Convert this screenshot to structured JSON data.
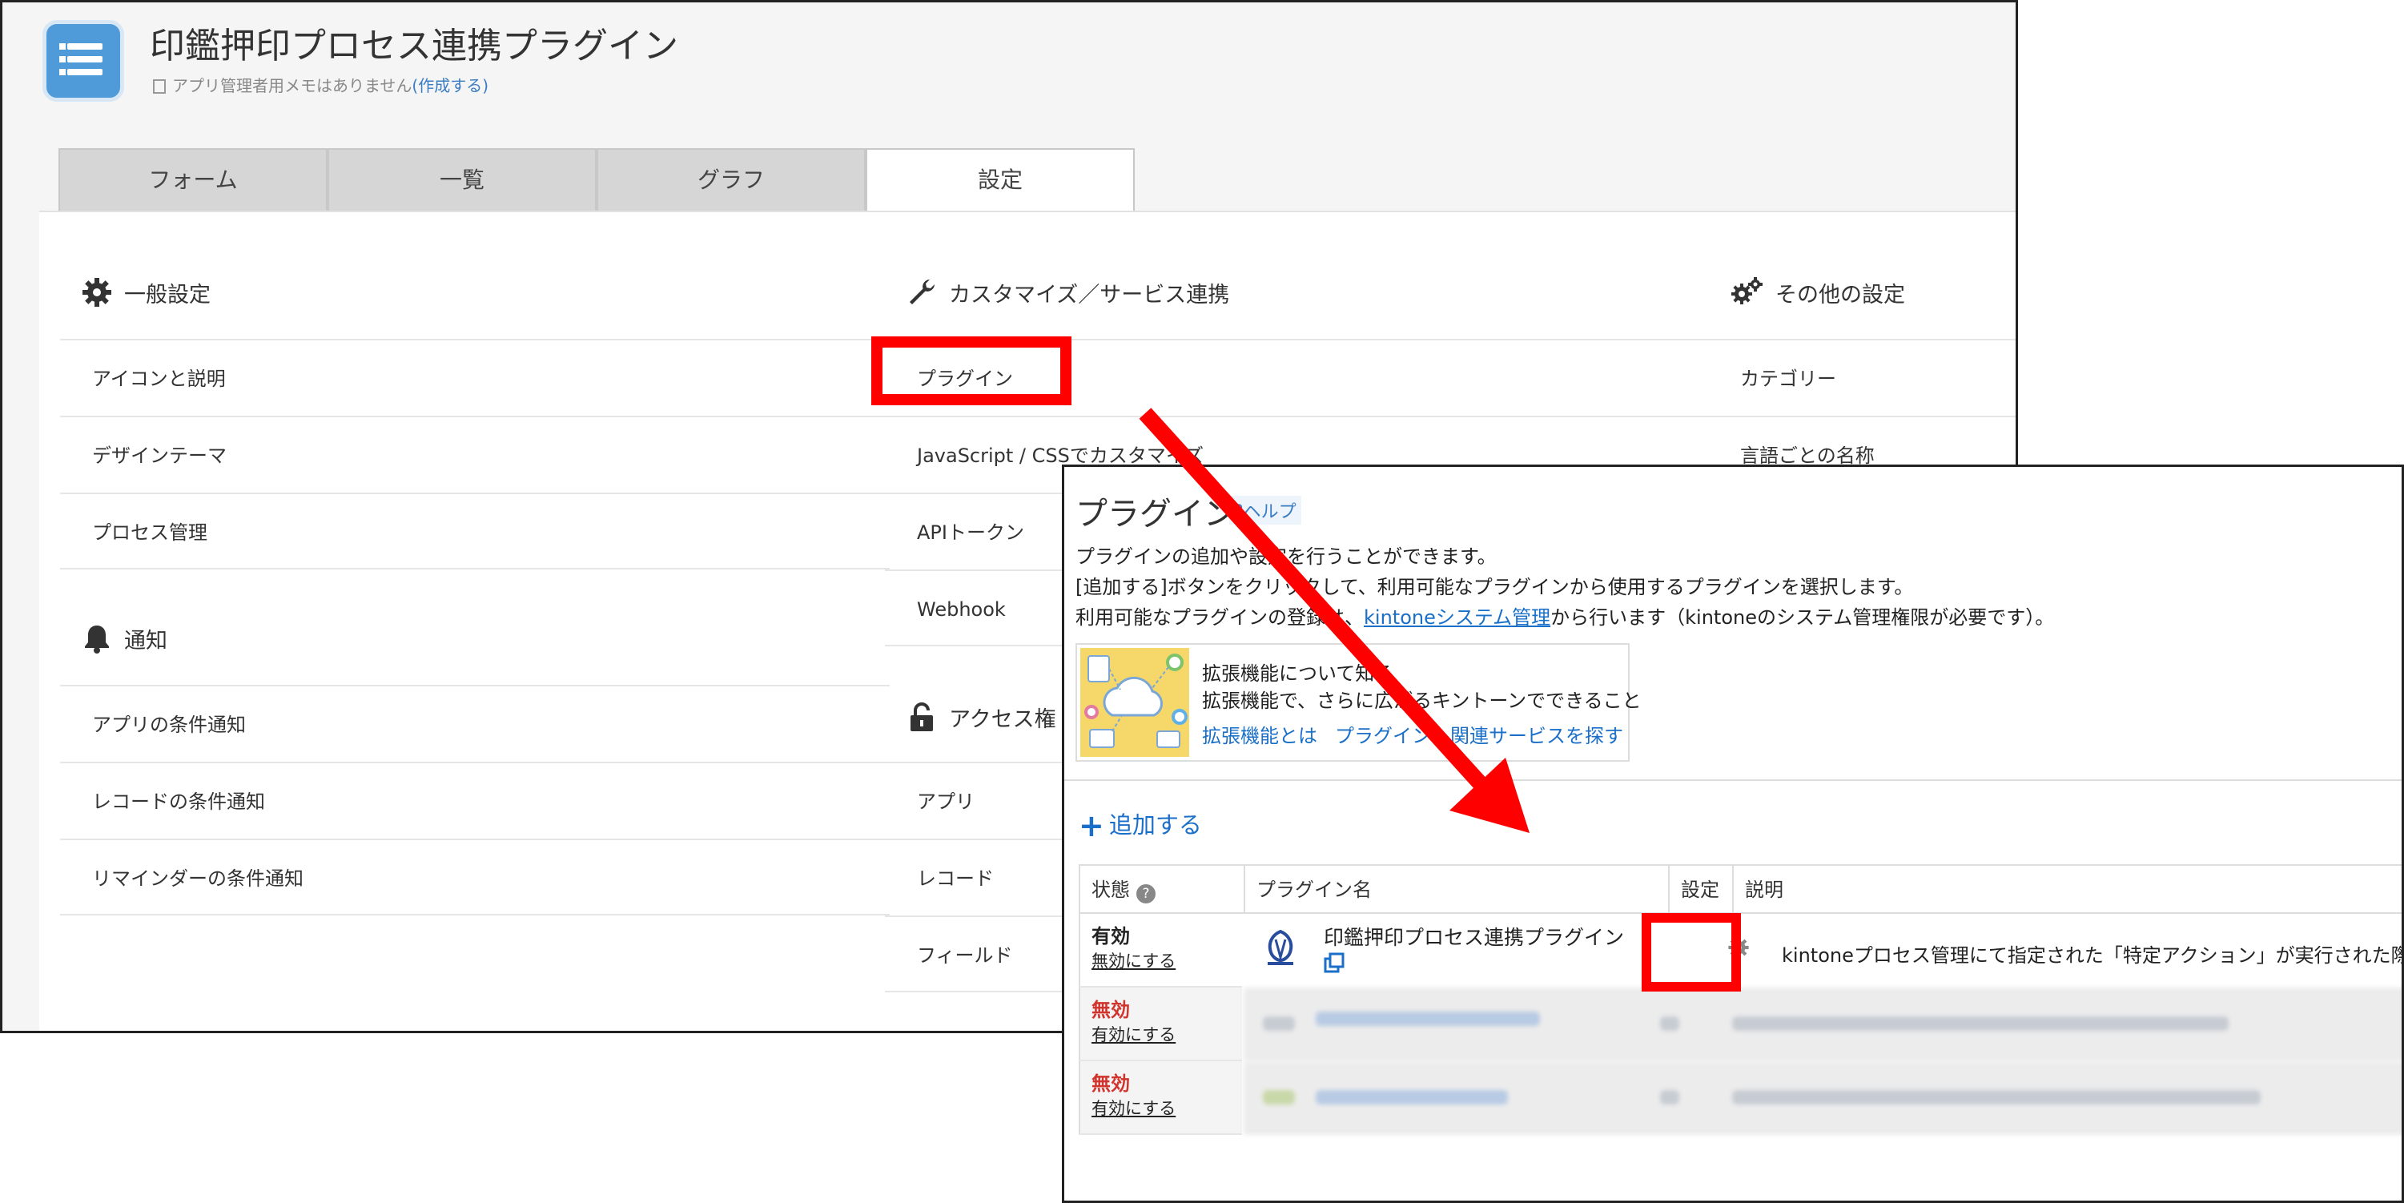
{
  "app": {
    "title": "印鑑押印プロセス連携プラグイン",
    "memo_text": "アプリ管理者用メモはありません",
    "memo_link": "(作成する)"
  },
  "tabs": [
    "フォーム",
    "一覧",
    "グラフ",
    "設定"
  ],
  "settings": {
    "general": {
      "header": "一般設定",
      "items": [
        "アイコンと説明",
        "デザインテーマ",
        "プロセス管理"
      ]
    },
    "notify": {
      "header": "通知",
      "items": [
        "アプリの条件通知",
        "レコードの条件通知",
        "リマインダーの条件通知"
      ]
    },
    "customize": {
      "header": "カスタマイズ／サービス連携",
      "items": [
        "プラグイン",
        "JavaScript / CSSでカスタマイズ",
        "APIトークン",
        "Webhook"
      ]
    },
    "access": {
      "header": "アクセス権",
      "items": [
        "アプリ",
        "レコード",
        "フィールド"
      ]
    },
    "other": {
      "header": "その他の設定",
      "items": [
        "カテゴリー",
        "言語ごとの名称"
      ]
    }
  },
  "plugins_page": {
    "title": "プラグイン",
    "help": "?ヘルプ",
    "desc1": "プラグインの追加や設定を行うことができます。",
    "desc2": "[追加する]ボタンをクリックして、利用可能なプラグインから使用するプラグインを選択します。",
    "desc3_pre": "利用可能なプラグインの登録は、",
    "desc3_link": "kintoneシステム管理",
    "desc3_post": "から行います（kintoneのシステム管理権限が必要です）。",
    "ext_title": "拡張機能について知る",
    "ext_sub": "拡張機能で、さらに広がるキントーンでできること",
    "ext_link1": "拡張機能とは",
    "ext_link2": "プラグイン・関連サービスを探す",
    "add_label": "追加する",
    "table": {
      "col_status": "状態",
      "col_name": "プラグイン名",
      "col_settings": "設定",
      "col_desc": "説明",
      "rows": [
        {
          "status": "有効",
          "action": "無効にする",
          "name": "印鑑押印プロセス連携プラグイン",
          "description": "kintoneプロセス管理にて指定された「特定アクション」が実行された際に、"
        },
        {
          "status": "無効",
          "action": "有効にする"
        },
        {
          "status": "無効",
          "action": "有効にする"
        }
      ]
    }
  },
  "colors": {
    "highlight": "#ff0000",
    "link": "#1a6fc8",
    "disabled_status": "#d0342c",
    "app_icon": "#4f9bd9"
  }
}
